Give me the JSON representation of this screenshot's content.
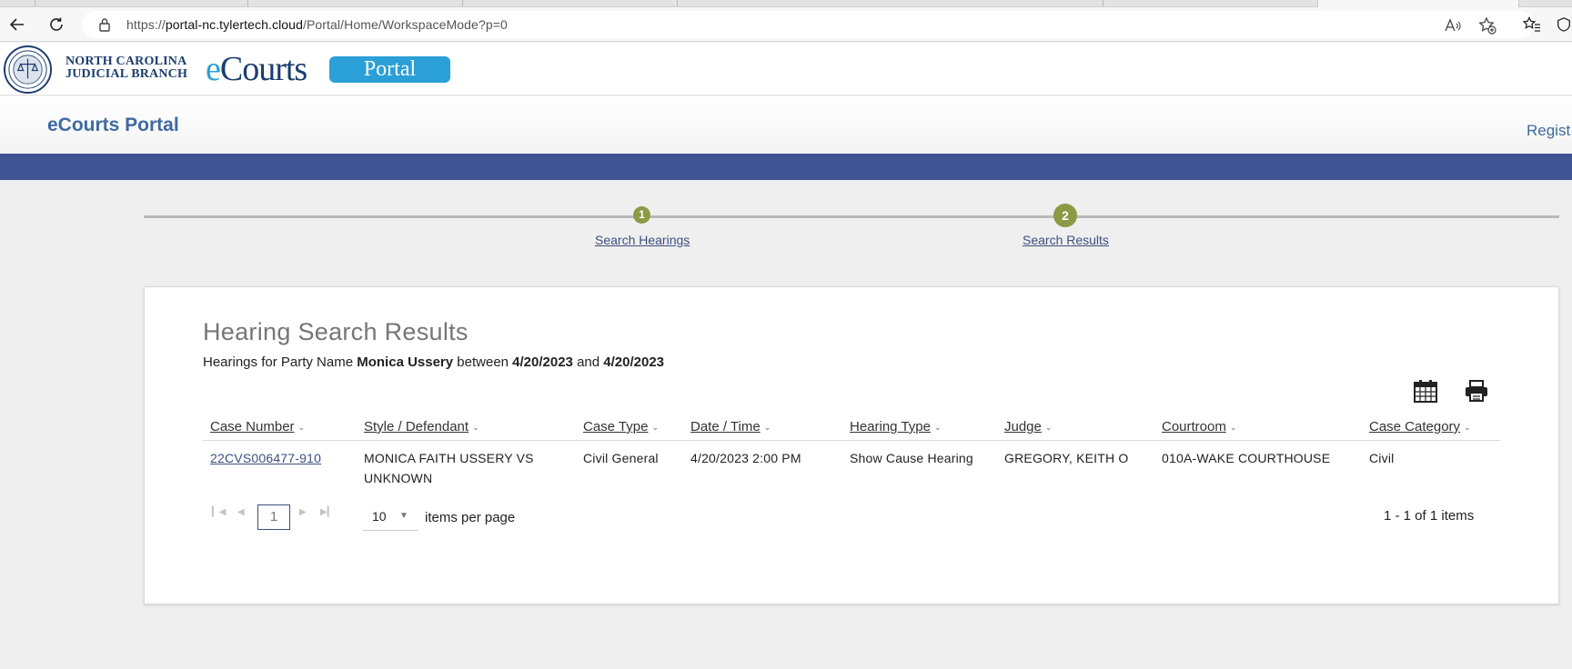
{
  "browser": {
    "url_prefix": "https://",
    "url_host": "portal-nc.tylertech.cloud",
    "url_path": "/Portal/Home/WorkspaceMode?p=0"
  },
  "site": {
    "branch_line1": "NORTH CAROLINA",
    "branch_line2": "JUDICIAL BRANCH",
    "logo_e": "e",
    "logo_rest": "Courts",
    "portal_pill": "Portal",
    "subheader_title": "eCourts Portal",
    "register_link": "Regist"
  },
  "stepper": {
    "steps": [
      {
        "number": "1",
        "label": "Search Hearings"
      },
      {
        "number": "2",
        "label": "Search Results"
      }
    ]
  },
  "results": {
    "heading": "Hearing Search Results",
    "summary_prefix": "Hearings for Party Name ",
    "party_name": "Monica Ussery",
    "summary_between": " between ",
    "date_from": "4/20/2023",
    "summary_and": " and ",
    "date_to": "4/20/2023",
    "columns": [
      "Case Number",
      "Style / Defendant",
      "Case Type",
      "Date / Time",
      "Hearing Type",
      "Judge",
      "Courtroom",
      "Case Category"
    ],
    "rows": [
      {
        "case_number": "22CVS006477-910",
        "style_line1": "MONICA FAITH USSERY VS",
        "style_line2": "UNKNOWN",
        "case_type": "Civil General",
        "date_time": "4/20/2023 2:00 PM",
        "hearing_type": "Show Cause Hearing",
        "judge": "GREGORY, KEITH O",
        "courtroom": "010A-WAKE COURTHOUSE",
        "case_category": "Civil"
      }
    ],
    "pager": {
      "current_page": "1",
      "page_size": "10",
      "items_per_page_label": "items per page",
      "item_count": "1 - 1 of 1 items"
    }
  },
  "colors": {
    "navbar": "#405392",
    "step_dot": "#8a9a45",
    "link": "#3d4f7e",
    "portal_pill": "#2b9fd7",
    "brand_title": "#3e6aa0"
  }
}
